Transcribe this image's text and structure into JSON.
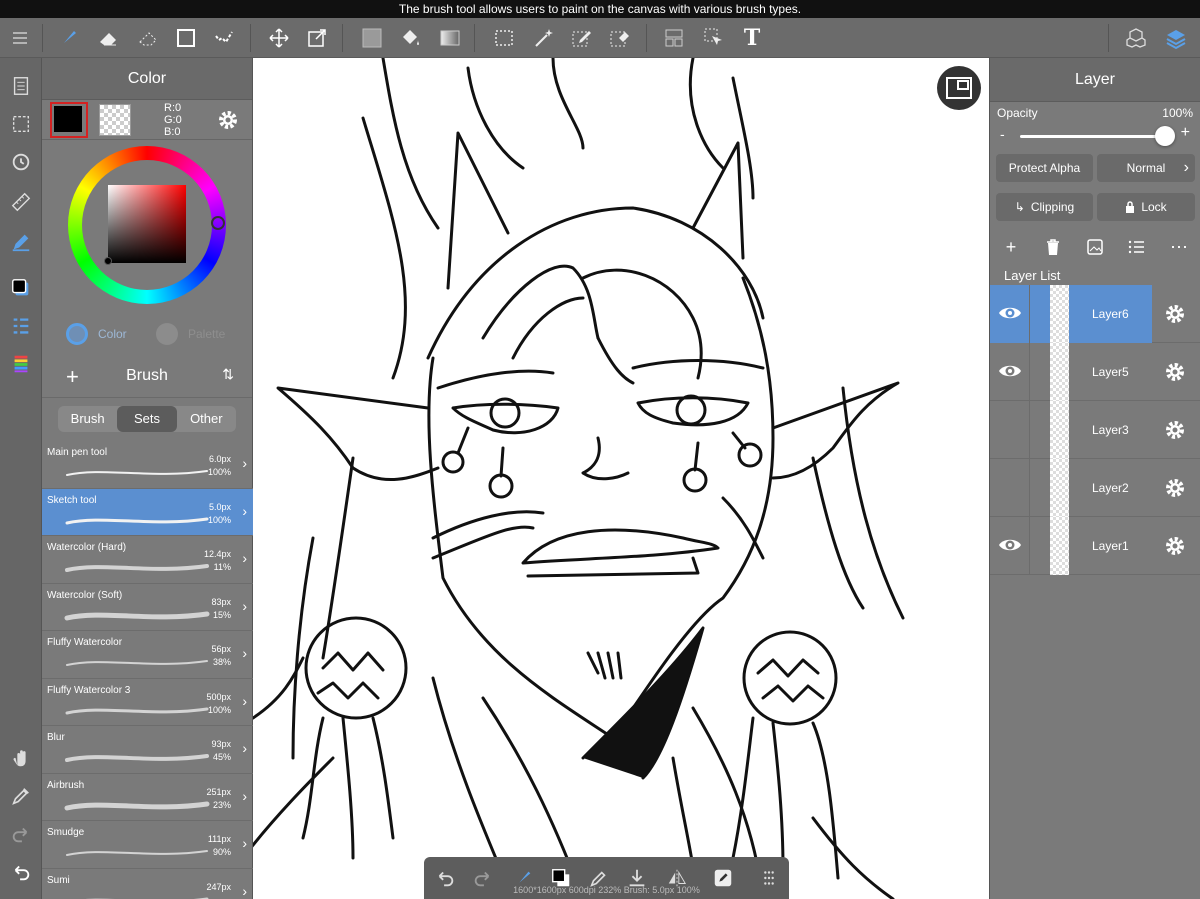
{
  "status_bar": {
    "caption": "The brush tool allows users to paint on the canvas with various brush types."
  },
  "toolbar": {
    "icons": [
      "menu-icon",
      "brush-icon",
      "eraser-icon",
      "selection-eraser-icon",
      "rectangle-icon",
      "dot-icon",
      "move-icon",
      "transform-icon",
      "fill-color-icon",
      "bucket-icon",
      "gradient-icon",
      "select-rect-icon",
      "magic-wand-icon",
      "select-pen-icon",
      "select-eraser-icon",
      "layout-icon",
      "select-pointer-icon",
      "text-icon",
      "material-icon",
      "layers-icon"
    ],
    "text_tool_label": "T"
  },
  "color_panel": {
    "title": "Color",
    "rgb": {
      "r": "R:0",
      "g": "G:0",
      "b": "B:0"
    },
    "primary_color": "#000000",
    "tabs": [
      {
        "label": "Color"
      },
      {
        "label": "Palette"
      }
    ]
  },
  "brush_panel": {
    "title": "Brush",
    "add_label": "+",
    "tabs": [
      {
        "label": "Brush"
      },
      {
        "label": "Sets"
      },
      {
        "label": "Other"
      }
    ],
    "selected_tab": "Sets",
    "brushes": [
      {
        "name": "Main pen tool",
        "size": "6.0px",
        "opacity": "100%"
      },
      {
        "name": "Sketch tool",
        "size": "5.0px",
        "opacity": "100%"
      },
      {
        "name": "Watercolor (Hard)",
        "size": "12.4px",
        "opacity": "11%"
      },
      {
        "name": "Watercolor (Soft)",
        "size": "83px",
        "opacity": "15%"
      },
      {
        "name": "Fluffy Watercolor",
        "size": "56px",
        "opacity": "38%"
      },
      {
        "name": "Fluffy Watercolor 3",
        "size": "500px",
        "opacity": "100%"
      },
      {
        "name": "Blur",
        "size": "93px",
        "opacity": "45%"
      },
      {
        "name": "Airbrush",
        "size": "251px",
        "opacity": "23%"
      },
      {
        "name": "Smudge",
        "size": "111px",
        "opacity": "90%"
      },
      {
        "name": "Sumi",
        "size": "247px",
        "opacity": ""
      }
    ],
    "selected_brush": "Sketch tool"
  },
  "canvas": {
    "status": "1600*1600px 600dpi 232% Brush: 5.0px 100%"
  },
  "layer_panel": {
    "title": "Layer",
    "opacity_label": "Opacity",
    "opacity_value": "100%",
    "opacity_fraction": 1.0,
    "minus_label": "-",
    "plus_label": "+",
    "protect_alpha_label": "Protect Alpha",
    "blend_mode": "Normal",
    "clipping_label": "Clipping",
    "lock_label": "Lock",
    "list_label": "Layer List",
    "layers": [
      {
        "name": "Layer6",
        "visible": true,
        "selected": true
      },
      {
        "name": "Layer5",
        "visible": true,
        "selected": false
      },
      {
        "name": "Layer3",
        "visible": false,
        "selected": false
      },
      {
        "name": "Layer2",
        "visible": false,
        "selected": false
      },
      {
        "name": "Layer1",
        "visible": true,
        "selected": false
      }
    ]
  },
  "colors": {
    "accent": "#5b8fd0",
    "panel": "#7a7a7a",
    "selection_border": "#d42222"
  }
}
